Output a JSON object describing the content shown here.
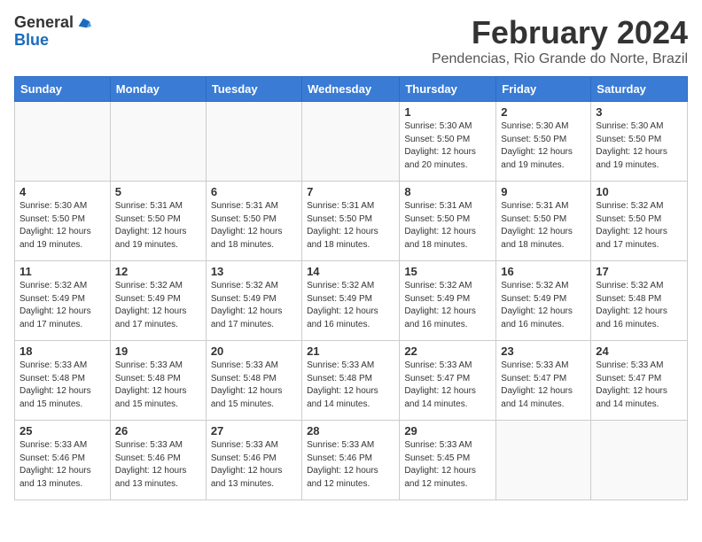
{
  "header": {
    "logo_line1": "General",
    "logo_line2": "Blue",
    "month_year": "February 2024",
    "location": "Pendencias, Rio Grande do Norte, Brazil"
  },
  "days_of_week": [
    "Sunday",
    "Monday",
    "Tuesday",
    "Wednesday",
    "Thursday",
    "Friday",
    "Saturday"
  ],
  "weeks": [
    [
      {
        "day": "",
        "info": ""
      },
      {
        "day": "",
        "info": ""
      },
      {
        "day": "",
        "info": ""
      },
      {
        "day": "",
        "info": ""
      },
      {
        "day": "1",
        "info": "Sunrise: 5:30 AM\nSunset: 5:50 PM\nDaylight: 12 hours\nand 20 minutes."
      },
      {
        "day": "2",
        "info": "Sunrise: 5:30 AM\nSunset: 5:50 PM\nDaylight: 12 hours\nand 19 minutes."
      },
      {
        "day": "3",
        "info": "Sunrise: 5:30 AM\nSunset: 5:50 PM\nDaylight: 12 hours\nand 19 minutes."
      }
    ],
    [
      {
        "day": "4",
        "info": "Sunrise: 5:30 AM\nSunset: 5:50 PM\nDaylight: 12 hours\nand 19 minutes."
      },
      {
        "day": "5",
        "info": "Sunrise: 5:31 AM\nSunset: 5:50 PM\nDaylight: 12 hours\nand 19 minutes."
      },
      {
        "day": "6",
        "info": "Sunrise: 5:31 AM\nSunset: 5:50 PM\nDaylight: 12 hours\nand 18 minutes."
      },
      {
        "day": "7",
        "info": "Sunrise: 5:31 AM\nSunset: 5:50 PM\nDaylight: 12 hours\nand 18 minutes."
      },
      {
        "day": "8",
        "info": "Sunrise: 5:31 AM\nSunset: 5:50 PM\nDaylight: 12 hours\nand 18 minutes."
      },
      {
        "day": "9",
        "info": "Sunrise: 5:31 AM\nSunset: 5:50 PM\nDaylight: 12 hours\nand 18 minutes."
      },
      {
        "day": "10",
        "info": "Sunrise: 5:32 AM\nSunset: 5:50 PM\nDaylight: 12 hours\nand 17 minutes."
      }
    ],
    [
      {
        "day": "11",
        "info": "Sunrise: 5:32 AM\nSunset: 5:49 PM\nDaylight: 12 hours\nand 17 minutes."
      },
      {
        "day": "12",
        "info": "Sunrise: 5:32 AM\nSunset: 5:49 PM\nDaylight: 12 hours\nand 17 minutes."
      },
      {
        "day": "13",
        "info": "Sunrise: 5:32 AM\nSunset: 5:49 PM\nDaylight: 12 hours\nand 17 minutes."
      },
      {
        "day": "14",
        "info": "Sunrise: 5:32 AM\nSunset: 5:49 PM\nDaylight: 12 hours\nand 16 minutes."
      },
      {
        "day": "15",
        "info": "Sunrise: 5:32 AM\nSunset: 5:49 PM\nDaylight: 12 hours\nand 16 minutes."
      },
      {
        "day": "16",
        "info": "Sunrise: 5:32 AM\nSunset: 5:49 PM\nDaylight: 12 hours\nand 16 minutes."
      },
      {
        "day": "17",
        "info": "Sunrise: 5:32 AM\nSunset: 5:48 PM\nDaylight: 12 hours\nand 16 minutes."
      }
    ],
    [
      {
        "day": "18",
        "info": "Sunrise: 5:33 AM\nSunset: 5:48 PM\nDaylight: 12 hours\nand 15 minutes."
      },
      {
        "day": "19",
        "info": "Sunrise: 5:33 AM\nSunset: 5:48 PM\nDaylight: 12 hours\nand 15 minutes."
      },
      {
        "day": "20",
        "info": "Sunrise: 5:33 AM\nSunset: 5:48 PM\nDaylight: 12 hours\nand 15 minutes."
      },
      {
        "day": "21",
        "info": "Sunrise: 5:33 AM\nSunset: 5:48 PM\nDaylight: 12 hours\nand 14 minutes."
      },
      {
        "day": "22",
        "info": "Sunrise: 5:33 AM\nSunset: 5:47 PM\nDaylight: 12 hours\nand 14 minutes."
      },
      {
        "day": "23",
        "info": "Sunrise: 5:33 AM\nSunset: 5:47 PM\nDaylight: 12 hours\nand 14 minutes."
      },
      {
        "day": "24",
        "info": "Sunrise: 5:33 AM\nSunset: 5:47 PM\nDaylight: 12 hours\nand 14 minutes."
      }
    ],
    [
      {
        "day": "25",
        "info": "Sunrise: 5:33 AM\nSunset: 5:46 PM\nDaylight: 12 hours\nand 13 minutes."
      },
      {
        "day": "26",
        "info": "Sunrise: 5:33 AM\nSunset: 5:46 PM\nDaylight: 12 hours\nand 13 minutes."
      },
      {
        "day": "27",
        "info": "Sunrise: 5:33 AM\nSunset: 5:46 PM\nDaylight: 12 hours\nand 13 minutes."
      },
      {
        "day": "28",
        "info": "Sunrise: 5:33 AM\nSunset: 5:46 PM\nDaylight: 12 hours\nand 12 minutes."
      },
      {
        "day": "29",
        "info": "Sunrise: 5:33 AM\nSunset: 5:45 PM\nDaylight: 12 hours\nand 12 minutes."
      },
      {
        "day": "",
        "info": ""
      },
      {
        "day": "",
        "info": ""
      }
    ]
  ]
}
